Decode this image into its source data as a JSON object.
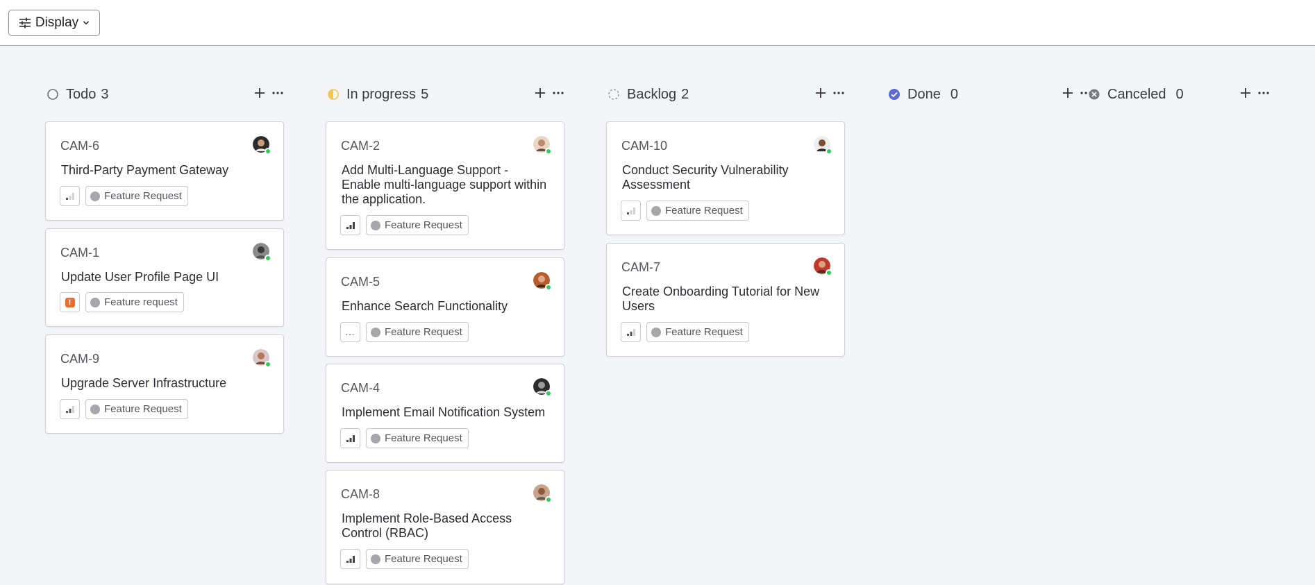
{
  "toolbar": {
    "display_label": "Display",
    "display_icon": "sliders-icon",
    "chevron_icon": "chevron-down-icon"
  },
  "colors": {
    "todo": "#6b6b73",
    "in_progress": "#f2c94c",
    "backlog": "#9a9aa2",
    "done": "#5e6ad2",
    "canceled": "#7a7a82",
    "online_dot": "#2ecc5f",
    "urgent": "#f06a2c"
  },
  "columns": [
    {
      "title": "Todo",
      "count": "3",
      "status_icon": "todo-circle-icon",
      "cards": [
        {
          "id": "CAM-6",
          "title": "Third-Party Payment Gateway",
          "priority": "low",
          "priority_icon": "signal-low-icon",
          "label": "Feature Request"
        },
        {
          "id": "CAM-1",
          "title": "Update User Profile Page UI",
          "priority": "urgent",
          "priority_icon": "urgent-icon",
          "priority_text": "!",
          "label": "Feature request"
        },
        {
          "id": "CAM-9",
          "title": "Upgrade Server Infrastructure",
          "priority": "medium",
          "priority_icon": "signal-medium-icon",
          "label": "Feature Request"
        }
      ]
    },
    {
      "title": "In progress",
      "count": "5",
      "status_icon": "half-circle-icon",
      "cards": [
        {
          "id": "CAM-2",
          "title": "Add Multi-Language Support - Enable multi-language support within the application.",
          "priority": "high",
          "priority_icon": "signal-high-icon",
          "label": "Feature Request"
        },
        {
          "id": "CAM-5",
          "title": "Enhance Search Functionality",
          "priority": "none",
          "priority_icon": "no-priority-icon",
          "priority_text": "...",
          "label": "Feature Request"
        },
        {
          "id": "CAM-4",
          "title": "Implement Email Notification System",
          "priority": "high",
          "priority_icon": "signal-high-icon",
          "label": "Feature Request"
        },
        {
          "id": "CAM-8",
          "title": "Implement Role-Based Access Control (RBAC)",
          "priority": "high",
          "priority_icon": "signal-high-icon",
          "label": "Feature Request"
        }
      ]
    },
    {
      "title": "Backlog",
      "count": "2",
      "status_icon": "dashed-circle-icon",
      "cards": [
        {
          "id": "CAM-10",
          "title": "Conduct Security Vulnerability Assessment",
          "priority": "low",
          "priority_icon": "signal-low-icon",
          "label": "Feature Request"
        },
        {
          "id": "CAM-7",
          "title": "Create Onboarding Tutorial for New Users",
          "priority": "medium",
          "priority_icon": "signal-medium-icon",
          "label": "Feature Request"
        }
      ]
    },
    {
      "title": "Done",
      "count": "0",
      "status_icon": "check-circle-icon",
      "cards": []
    },
    {
      "title": "Canceled",
      "count": "0",
      "status_icon": "x-circle-icon",
      "cards": []
    }
  ]
}
